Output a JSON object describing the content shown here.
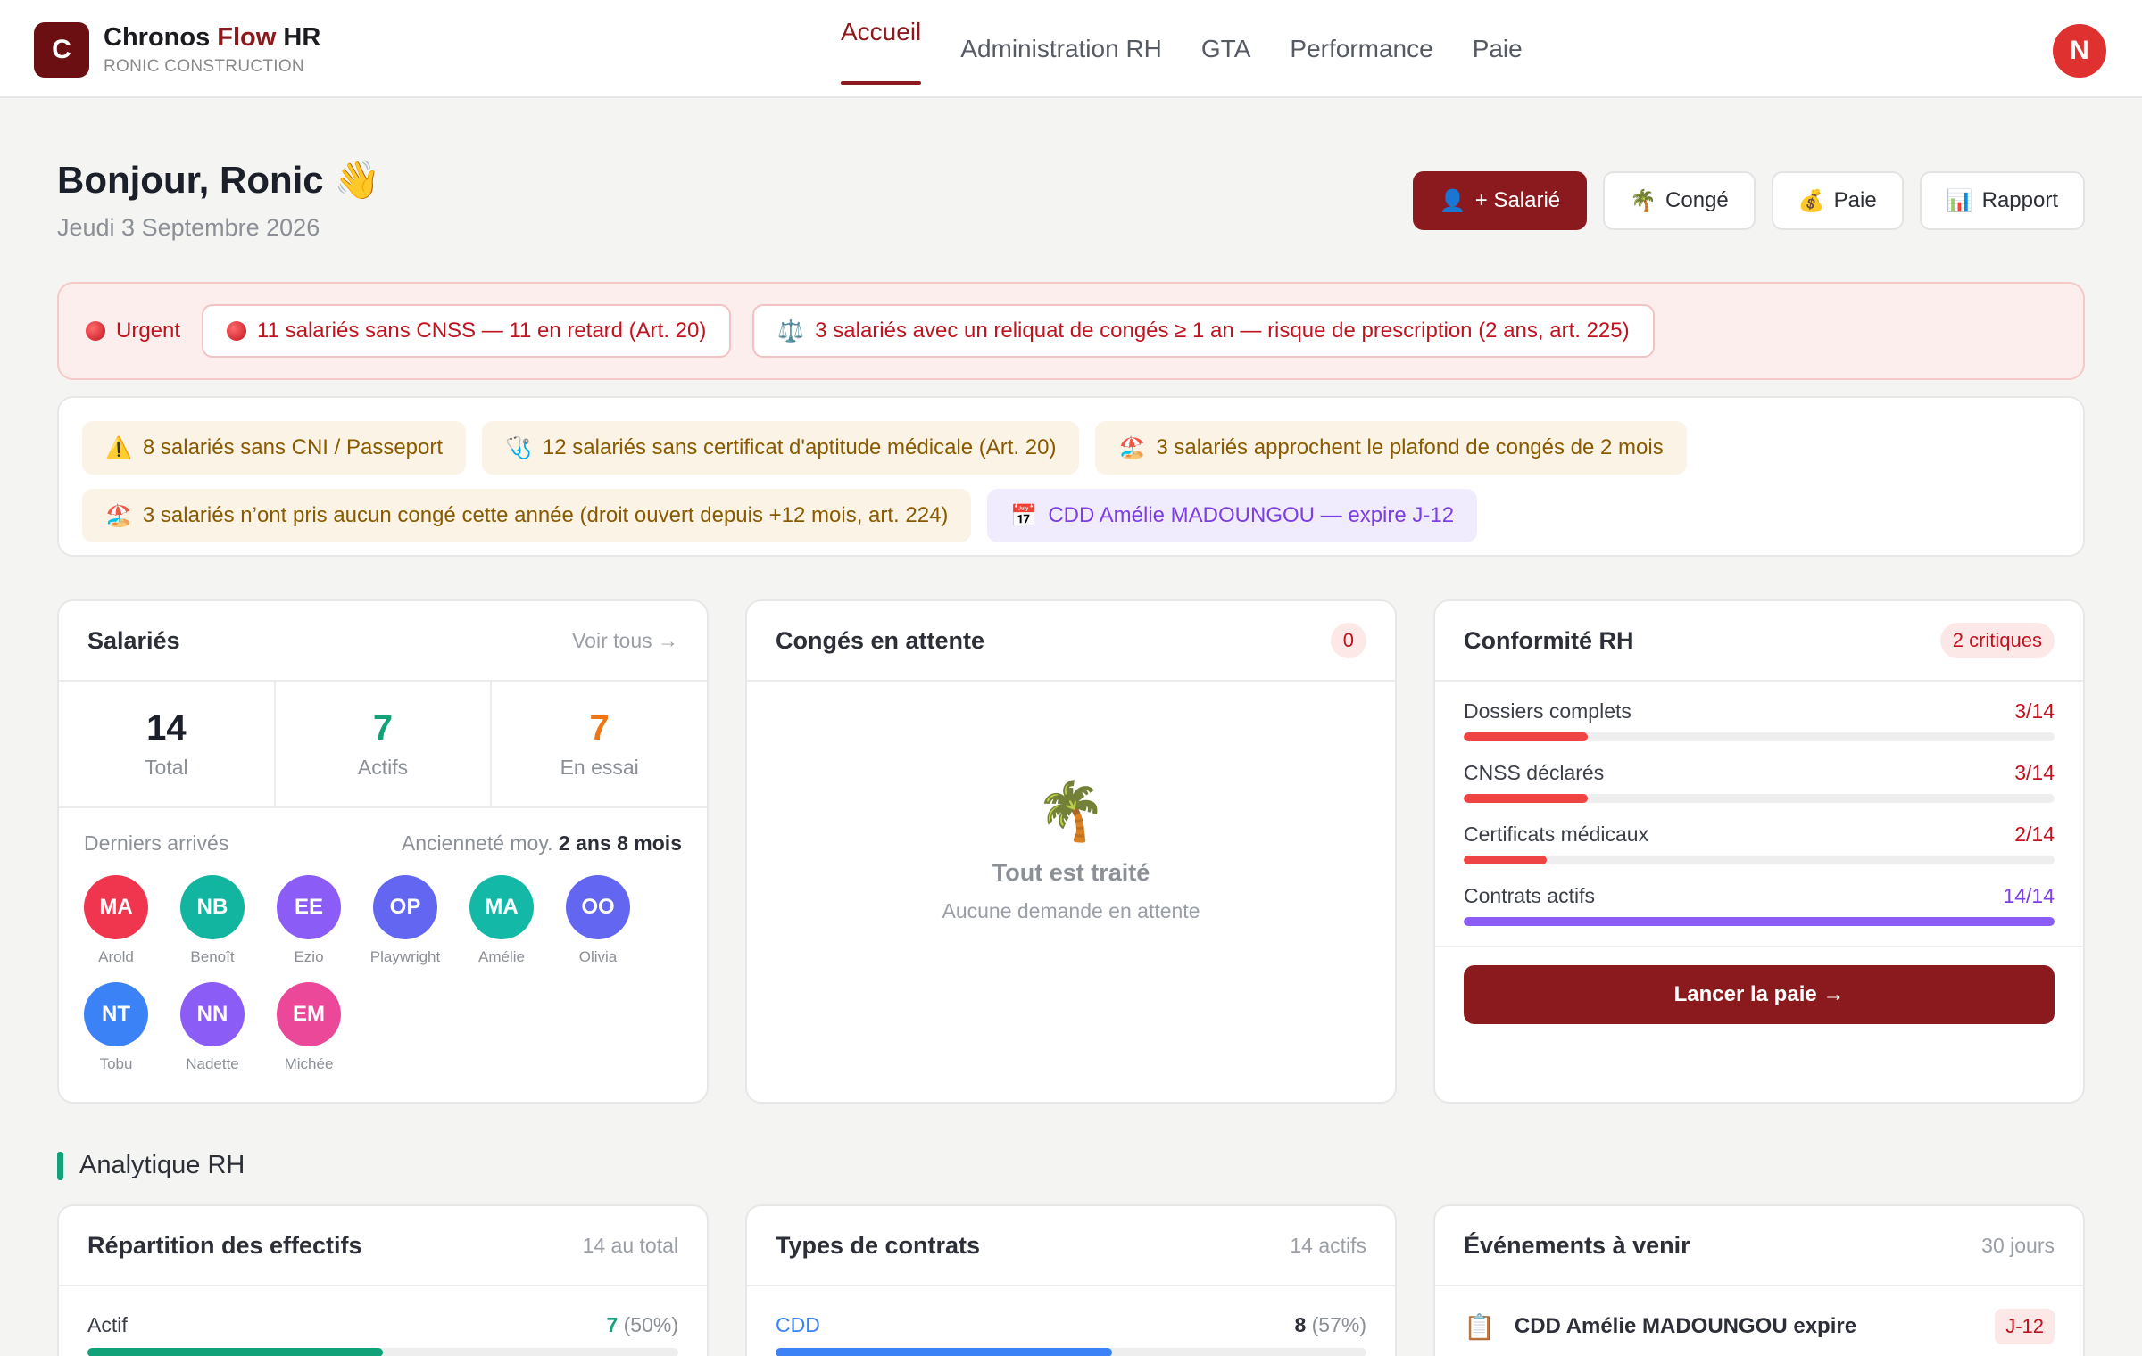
{
  "app": {
    "logo_letter": "C",
    "brand_main": "Chronos ",
    "brand_accent": "Flow",
    "brand_suffix": " HR",
    "company": "RONIC CONSTRUCTION",
    "user_initial": "N"
  },
  "nav": [
    {
      "label": "Accueil",
      "active": true
    },
    {
      "label": "Administration RH"
    },
    {
      "label": "GTA"
    },
    {
      "label": "Performance"
    },
    {
      "label": "Paie"
    }
  ],
  "greeting": {
    "title": "Bonjour, Ronic 👋",
    "date": "Jeudi 3 Septembre 2026"
  },
  "actions": {
    "salarie": {
      "icon": "👤",
      "label": "+ Salarié"
    },
    "conge": {
      "icon": "🌴",
      "label": "Congé"
    },
    "paie": {
      "icon": "💰",
      "label": "Paie"
    },
    "rapport": {
      "icon": "📊",
      "label": "Rapport"
    }
  },
  "alerts": {
    "urgent_label": "Urgent",
    "urgent": [
      {
        "icon": "🔴",
        "text": "11 salariés sans CNSS — 11 en retard (Art. 20)"
      },
      {
        "icon": "⚖️",
        "text": "3 salariés avec un reliquat de congés ≥ 1 an — risque de prescription (2 ans, art. 225)"
      }
    ],
    "warnings": [
      {
        "icon": "⚠️",
        "text": "8 salariés sans CNI / Passeport",
        "tone": "amber"
      },
      {
        "icon": "🩺",
        "text": "12 salariés sans certificat d'aptitude médicale (Art. 20)",
        "tone": "amber"
      },
      {
        "icon": "🏖️",
        "text": "3 salariés approchent le plafond de congés de 2 mois",
        "tone": "amber"
      },
      {
        "icon": "🏖️",
        "text": "3 salariés n’ont pris aucun congé cette année (droit ouvert depuis +12 mois, art. 224)",
        "tone": "amber"
      },
      {
        "icon": "📅",
        "text": "CDD Amélie MADOUNGOU — expire J-12",
        "tone": "purple"
      }
    ]
  },
  "employees": {
    "title": "Salariés",
    "link": "Voir tous →",
    "stats": [
      {
        "value": "14",
        "label": "Total",
        "color": "#1b1f2a"
      },
      {
        "value": "7",
        "label": "Actifs",
        "color": "#12a27a"
      },
      {
        "value": "7",
        "label": "En essai",
        "color": "#f07613"
      }
    ],
    "recent_label": "Derniers arrivés",
    "seniority_label": "Ancienneté moy.",
    "seniority_value": "2 ans 8 mois",
    "people": [
      {
        "initials": "MA",
        "name": "Arold",
        "color": "#f0364f"
      },
      {
        "initials": "NB",
        "name": "Benoît",
        "color": "#12b5a0"
      },
      {
        "initials": "EE",
        "name": "Ezio",
        "color": "#8b5cf6"
      },
      {
        "initials": "OP",
        "name": "Playwright",
        "color": "#6366f1"
      },
      {
        "initials": "MA",
        "name": "Amélie",
        "color": "#14b8a6"
      },
      {
        "initials": "OO",
        "name": "Olivia",
        "color": "#6366f1"
      },
      {
        "initials": "NT",
        "name": "Tobu",
        "color": "#3b82f6"
      },
      {
        "initials": "NN",
        "name": "Nadette",
        "color": "#8b5cf6"
      },
      {
        "initials": "EM",
        "name": "Michée",
        "color": "#ec4899"
      }
    ]
  },
  "leaves": {
    "title": "Congés en attente",
    "count": "0",
    "icon": "🌴",
    "empty_title": "Tout est traité",
    "empty_sub": "Aucune demande en attente"
  },
  "compliance": {
    "title": "Conformité RH",
    "badge": "2 critiques",
    "items": [
      {
        "label": "Dossiers complets",
        "value": "3/14",
        "pct": 21,
        "color": "#ef4444",
        "ok": false
      },
      {
        "label": "CNSS déclarés",
        "value": "3/14",
        "pct": 21,
        "color": "#ef4444",
        "ok": false
      },
      {
        "label": "Certificats médicaux",
        "value": "2/14",
        "pct": 14,
        "color": "#ef4444",
        "ok": false
      },
      {
        "label": "Contrats actifs",
        "value": "14/14",
        "pct": 100,
        "color": "#8b5cf6",
        "ok": true
      }
    ],
    "button": "Lancer la paie →"
  },
  "analytics": {
    "title": "Analytique RH",
    "distribution": {
      "title": "Répartition des effectifs",
      "meta": "14 au total",
      "label": "Actif",
      "count": "7",
      "share": "(50%)",
      "pct": 50,
      "color": "#12a27a"
    },
    "contracts": {
      "title": "Types de contrats",
      "meta": "14 actifs",
      "label": "CDD",
      "count": "8",
      "share": "(57%)",
      "pct": 57,
      "color": "#3b82f6"
    },
    "events": {
      "title": "Événements à venir",
      "meta": "30 jours",
      "icon": "📋",
      "text": "CDD Amélie MADOUNGOU expire",
      "badge": "J-12"
    }
  }
}
